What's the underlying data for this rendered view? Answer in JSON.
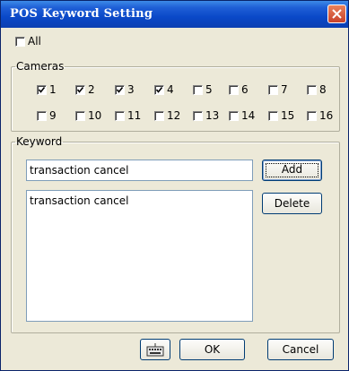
{
  "window": {
    "title": "POS Keyword Setting"
  },
  "all": {
    "label": "All",
    "checked": false
  },
  "cameras": {
    "legend": "Cameras",
    "items": [
      {
        "label": "1",
        "checked": true
      },
      {
        "label": "2",
        "checked": true
      },
      {
        "label": "3",
        "checked": true
      },
      {
        "label": "4",
        "checked": true
      },
      {
        "label": "5",
        "checked": false
      },
      {
        "label": "6",
        "checked": false
      },
      {
        "label": "7",
        "checked": false
      },
      {
        "label": "8",
        "checked": false
      },
      {
        "label": "9",
        "checked": false
      },
      {
        "label": "10",
        "checked": false
      },
      {
        "label": "11",
        "checked": false
      },
      {
        "label": "12",
        "checked": false
      },
      {
        "label": "13",
        "checked": false
      },
      {
        "label": "14",
        "checked": false
      },
      {
        "label": "15",
        "checked": false
      },
      {
        "label": "16",
        "checked": false
      }
    ]
  },
  "keyword": {
    "legend": "Keyword",
    "input_value": "transaction cancel",
    "add_label": "Add",
    "delete_label": "Delete",
    "list": [
      "transaction cancel"
    ]
  },
  "footer": {
    "ok_label": "OK",
    "cancel_label": "Cancel",
    "keyboard_icon": "keyboard-icon"
  }
}
